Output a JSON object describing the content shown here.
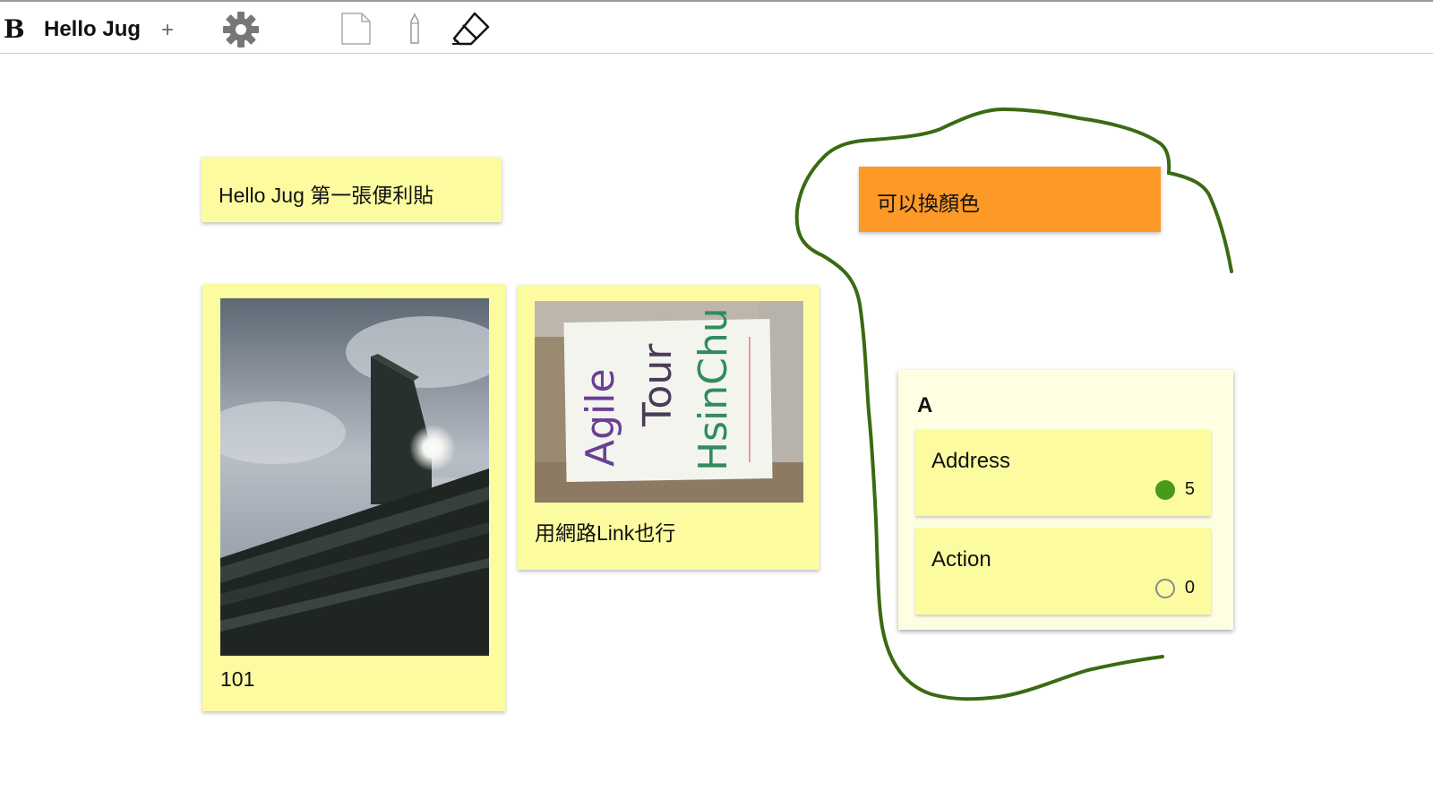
{
  "toolbar": {
    "logo": "B",
    "board_title": "Hello Jug",
    "add_label": "+",
    "icons": [
      "gear-icon",
      "new-note-icon",
      "pen-icon",
      "eraser-icon"
    ]
  },
  "notes": {
    "hello": "Hello Jug 第一張便利貼",
    "color": "可以換顏色",
    "photo1_caption": "101",
    "photo2_caption": "用網路Link也行"
  },
  "photo2_sign": {
    "line1": "Agile",
    "line2": "Tour",
    "line3": "HsinChu"
  },
  "group": {
    "title": "A",
    "cards": [
      {
        "label": "Address",
        "count": "5",
        "status": "filled"
      },
      {
        "label": "Action",
        "count": "0",
        "status": "empty"
      }
    ]
  },
  "colors": {
    "note_yellow": "#fdfba0",
    "note_orange": "#fd9a27",
    "drawing_green": "#3a6a12",
    "dot_green": "#4a9a1a"
  }
}
